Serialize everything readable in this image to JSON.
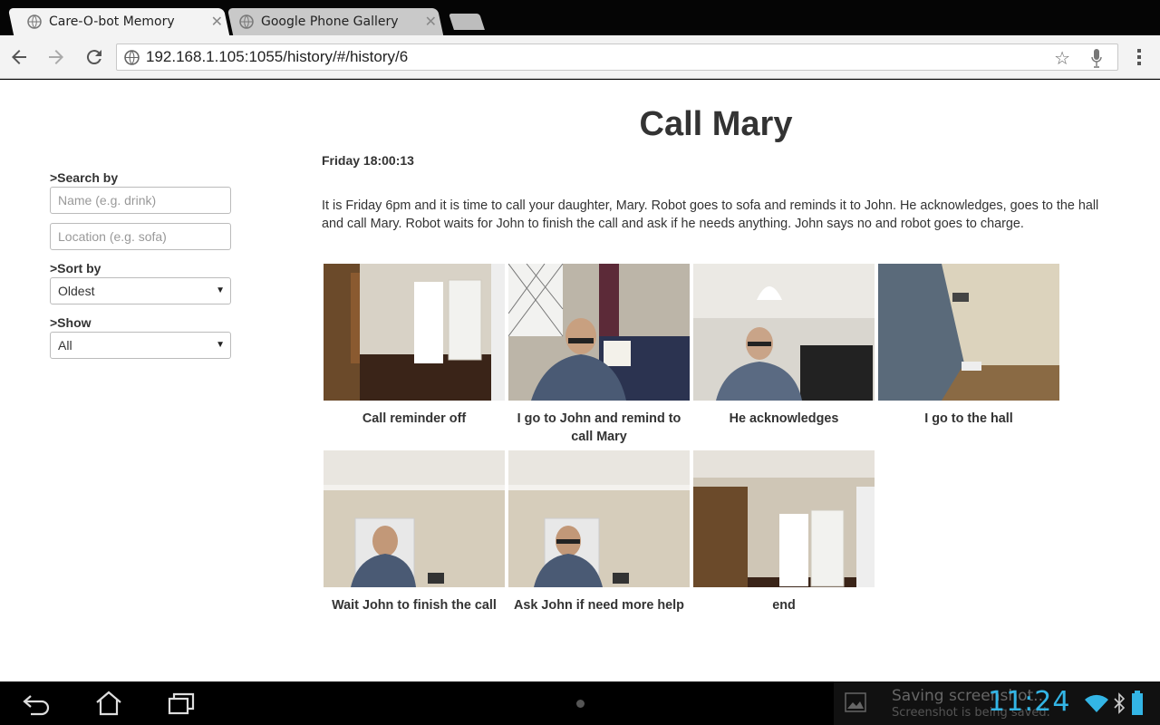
{
  "browser": {
    "tabs": [
      {
        "label": "Care-O-bot Memory",
        "active": true
      },
      {
        "label": "Google Phone Gallery",
        "active": false
      }
    ],
    "url": "192.168.1.105:1055/history/#/history/6"
  },
  "sidebar": {
    "search_label": ">Search by",
    "name_placeholder": "Name (e.g. drink)",
    "location_placeholder": "Location (e.g. sofa)",
    "sort_label": ">Sort by",
    "sort_value": "Oldest",
    "show_label": ">Show",
    "show_value": "All"
  },
  "event": {
    "title": "Call Mary",
    "timestamp": "Friday 18:00:13",
    "description": "It is Friday 6pm and it is time to call your daughter, Mary. Robot goes to sofa and reminds it to John. He acknowledges, goes to the hall and call Mary. Robot waits for John to finish the call and ask if he needs anything. John says no and robot goes to charge."
  },
  "steps": [
    {
      "caption": "Call reminder off"
    },
    {
      "caption": "I go to John and remind to call Mary"
    },
    {
      "caption": "He acknowledges"
    },
    {
      "caption": "I go to the hall"
    },
    {
      "caption": "Wait John to finish the call"
    },
    {
      "caption": "Ask John if need more help"
    },
    {
      "caption": "end"
    }
  ],
  "system": {
    "notification_title": "Saving screenshot...",
    "notification_sub": "Screenshot is being saved.",
    "clock": "11:24"
  }
}
